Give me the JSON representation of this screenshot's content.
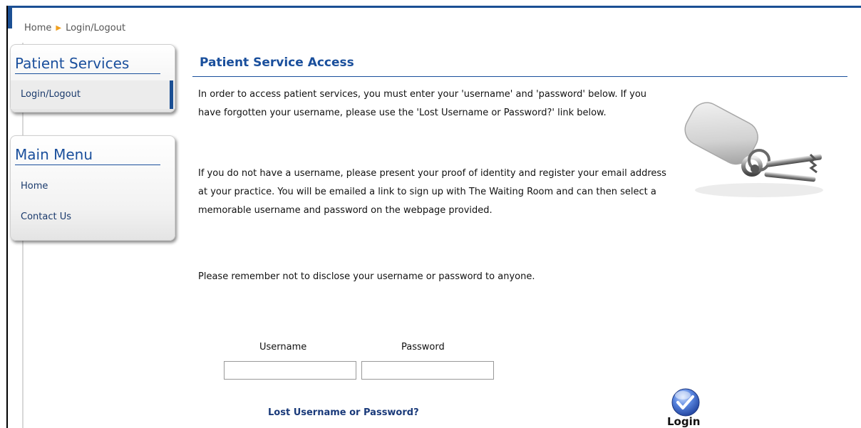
{
  "breadcrumb": {
    "home": "Home",
    "current": "Login/Logout"
  },
  "sidebar": {
    "patient_services": {
      "title": "Patient Services",
      "items": [
        {
          "label": "Login/Logout",
          "active": true
        }
      ]
    },
    "main_menu": {
      "title": "Main Menu",
      "items": [
        {
          "label": "Home"
        },
        {
          "label": "Contact Us"
        }
      ]
    }
  },
  "main": {
    "title": "Patient Service Access",
    "paragraphs": [
      "In order to access patient services, you must enter your 'username' and 'password' below. If you have forgotten your username, please use the 'Lost Username or Password?' link below.",
      "If you do not have a username, please present your proof of identity and register your email address at your practice. You will be emailed a link to sign up with The Waiting Room and can then select a memorable username and password on the webpage provided.",
      "Please remember not to disclose your username or password to anyone."
    ],
    "image_icon": "keys-icon"
  },
  "login_form": {
    "username_label": "Username",
    "username_value": "",
    "password_label": "Password",
    "password_value": "",
    "lost_link": "Lost Username or Password?",
    "login_label": "Login",
    "login_icon": "checkmark-icon"
  },
  "colors": {
    "brand_blue": "#1a4f9c",
    "accent_orange": "#f0a020"
  }
}
